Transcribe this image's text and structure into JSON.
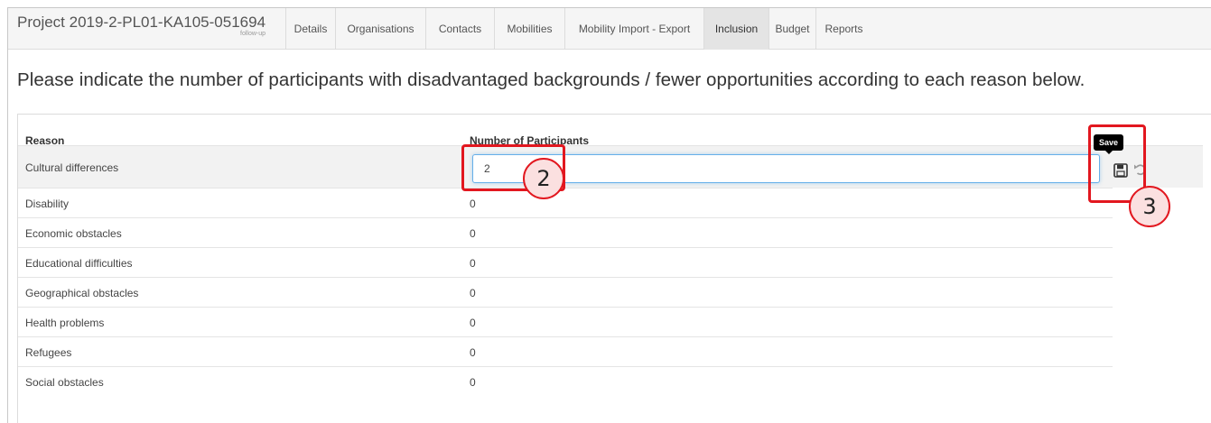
{
  "header": {
    "project_title": "Project 2019-2-PL01-KA105-051694",
    "project_subtitle": "follow-up",
    "tabs": [
      {
        "label": "Details"
      },
      {
        "label": "Organisations"
      },
      {
        "label": "Contacts"
      },
      {
        "label": "Mobilities"
      },
      {
        "label": "Mobility Import - Export"
      },
      {
        "label": "Inclusion",
        "active": true
      },
      {
        "label": "Budget"
      },
      {
        "label": "Reports"
      }
    ]
  },
  "instructions": "Please indicate the number of participants with disadvantaged backgrounds / fewer opportunities according to each reason below.",
  "table": {
    "columns": [
      "Reason",
      "Number of Participants"
    ],
    "rows": [
      {
        "reason": "Cultural differences",
        "value": "2",
        "editing": true
      },
      {
        "reason": "Disability",
        "value": "0"
      },
      {
        "reason": "Economic obstacles",
        "value": "0"
      },
      {
        "reason": "Educational difficulties",
        "value": "0"
      },
      {
        "reason": "Geographical obstacles",
        "value": "0"
      },
      {
        "reason": "Health problems",
        "value": "0"
      },
      {
        "reason": "Refugees",
        "value": "0"
      },
      {
        "reason": "Social obstacles",
        "value": "0"
      }
    ]
  },
  "row_actions": {
    "save_tooltip": "Save",
    "save_icon": "floppy-disk-icon",
    "undo_icon": "undo-icon"
  },
  "annotations": {
    "badge_2": "2",
    "badge_3": "3",
    "highlight_color": "#e2171f"
  }
}
